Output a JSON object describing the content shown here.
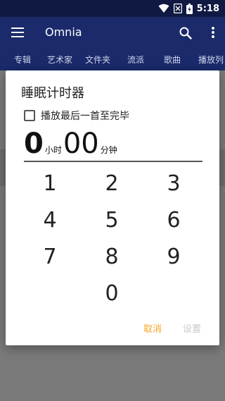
{
  "status_bar": {
    "time": "5:18",
    "icons": [
      "wifi-icon",
      "notification-muted-icon",
      "battery-icon"
    ]
  },
  "app_bar": {
    "title": "Omnia",
    "icons": [
      "menu-icon",
      "search-icon",
      "more-vert-icon"
    ]
  },
  "tabs": [
    "专辑",
    "艺术家",
    "文件夹",
    "流派",
    "歌曲",
    "播放列"
  ],
  "dialog": {
    "title": "睡眠计时器",
    "checkbox_label": "播放最后一首至完毕",
    "checkbox_checked": false,
    "hours_value": "0",
    "hours_unit": "小时",
    "minutes_value": "00",
    "minutes_unit": "分钟",
    "keys": [
      "1",
      "2",
      "3",
      "4",
      "5",
      "6",
      "7",
      "8",
      "9",
      "0"
    ],
    "cancel_label": "取消",
    "set_label": "设置"
  },
  "colors": {
    "status_bar": "#0f1942",
    "app_bar": "#1a2a6b",
    "accent": "#f5a623",
    "disabled": "#c8c8c8"
  }
}
